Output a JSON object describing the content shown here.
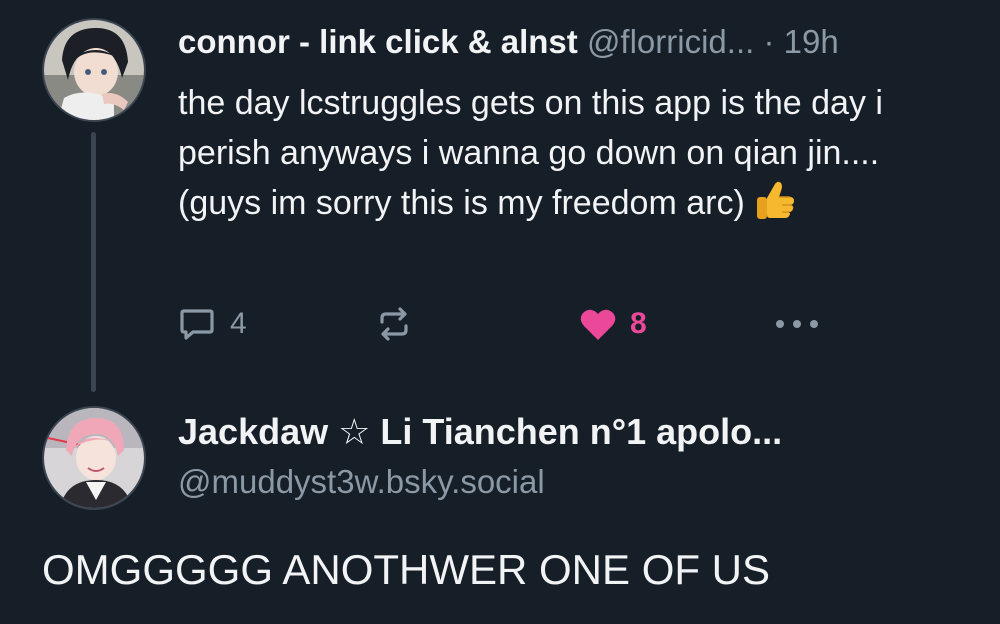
{
  "parent_post": {
    "author_name": "connor - link click & alnst",
    "author_handle": "@florricid...",
    "time": "· 19h",
    "text": "the day lcstruggles gets on this app is the day i perish anyways i wanna go down on qian jin.... (guys im sorry this is my freedom arc)",
    "emoji_icon": "thumbs-up-icon",
    "reply_count": "4",
    "like_count": "8",
    "like_color": "#ec4899"
  },
  "reply_post": {
    "author_name": "Jackdaw ☆ Li Tianchen n°1 apolo...",
    "author_handle": "@muddyst3w.bsky.social",
    "text": "OMGGGGG ANOTHWER ONE OF US"
  },
  "colors": {
    "background": "#161e27",
    "text_primary": "#f1f3f5",
    "text_secondary": "#8b98a5",
    "thread_line": "#3a4551"
  }
}
